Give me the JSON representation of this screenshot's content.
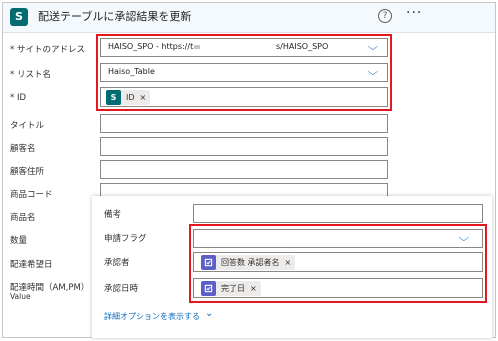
{
  "header": {
    "app_icon": "S",
    "title": "配送テーブルに承認結果を更新",
    "help_icon": "?",
    "more_icon": "···"
  },
  "fields": {
    "site": {
      "label": "* サイトのアドレス",
      "value_left": "HAISO_SPO - https://t",
      "value_right": "s/HAISO_SPO"
    },
    "list": {
      "label": "* リスト名",
      "value": "Haiso_Table"
    },
    "id": {
      "label": "* ID",
      "token_icon": "S",
      "token": "ID",
      "remove": "×"
    },
    "title": {
      "label": "タイトル"
    },
    "customer_name": {
      "label": "顧客名"
    },
    "customer_address": {
      "label": "顧客住所"
    },
    "product_code": {
      "label": "商品コード"
    },
    "product_name": {
      "label": "商品名"
    },
    "quantity": {
      "label": "数量"
    },
    "delivery_date": {
      "label": "配達希望日"
    },
    "delivery_time": {
      "label": "配達時間（AM,PM）",
      "sub": "Value"
    }
  },
  "overlay": {
    "remarks": {
      "label": "備考"
    },
    "flag": {
      "label": "申請フラグ"
    },
    "approver": {
      "label": "承認者",
      "token": "回答数 承認者名",
      "remove": "×"
    },
    "approval_date": {
      "label": "承認日時",
      "token": "完了日",
      "remove": "×"
    },
    "advanced_link": "詳細オプションを表示する",
    "advanced_chevron": "⌄"
  }
}
